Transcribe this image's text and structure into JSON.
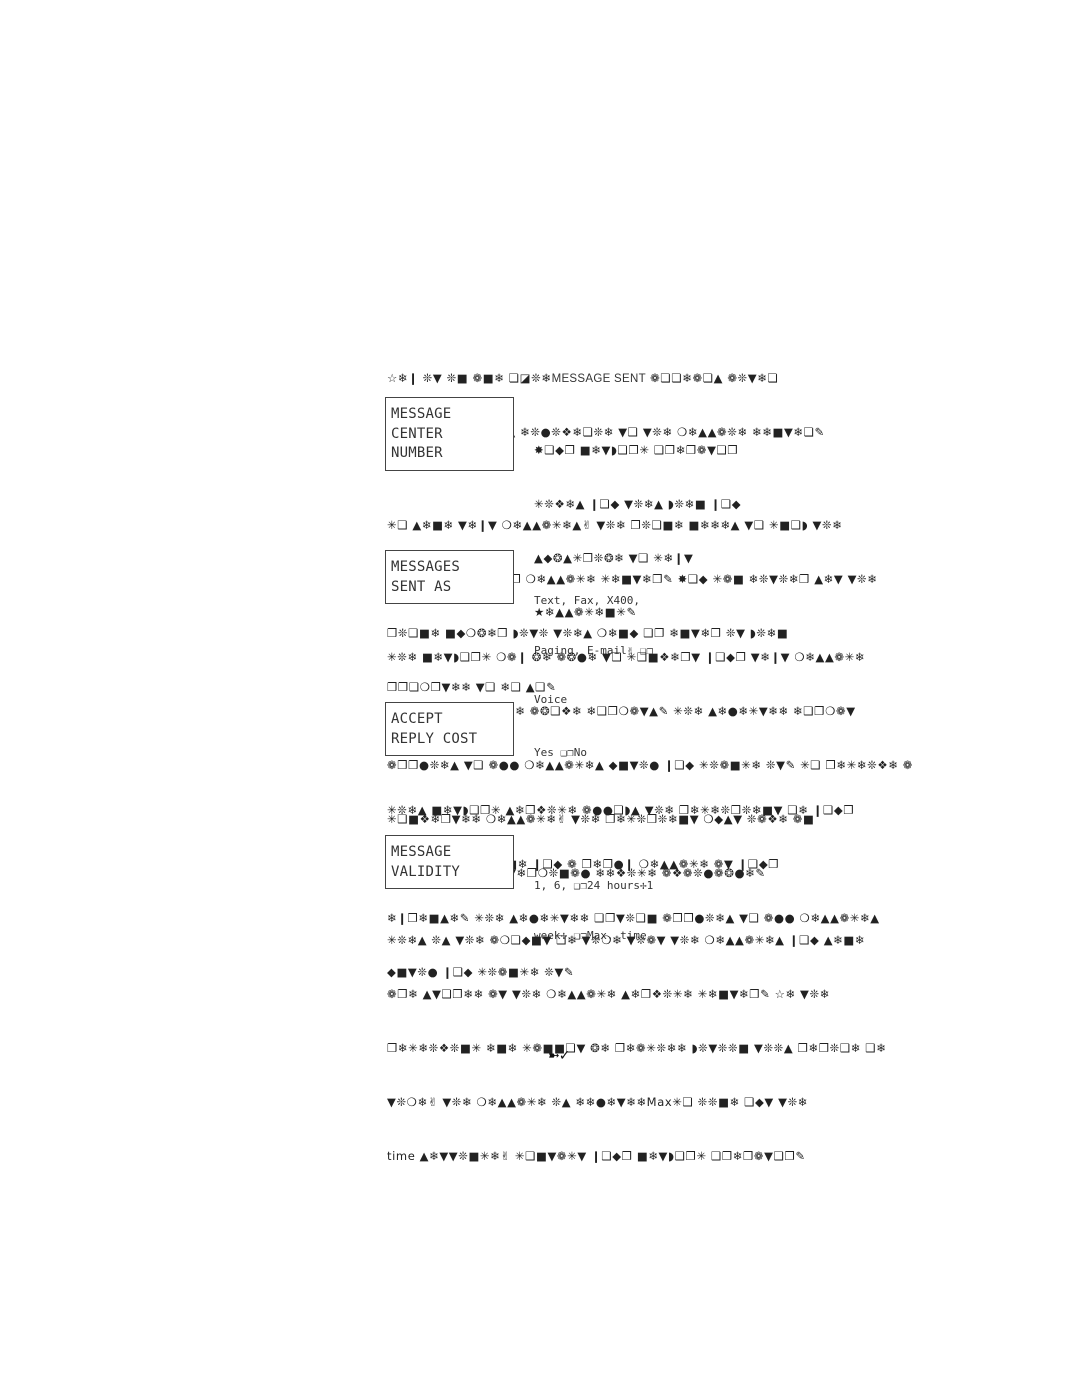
{
  "intro": {
    "lines": [
      "☆❄❙ ❊▼ ❊■ ❁■❄ ❏◪❊❄",
      "▼❊❄ ❍❄▲▲❁❊❄ ❊▲ ❄❊●❊❖❄❏❊❄ ▼❑ ▼❊❄ ❍❄▲▲❁❊❄ ❄❄■▼❄❏✎"
    ],
    "inline_readable": "MESSAGE SENT",
    "after_inline": " ❁❏❏❄❁❏▲ ❁❊▼❄❏"
  },
  "sections": [
    {
      "lcd_lines": [
        "MESSAGE",
        "CENTER",
        "NUMBER"
      ],
      "side_lines": [
        "✸❑◆❐ ■❄▼◗❑❐✳ ❑❐❄❐❁▼❑❐",
        "✳❊❖❄▲ ❙❑◆ ▼❊❄▲ ◗❊❄■ ❙❑◆",
        "▲◆❂▲✳❐❊❂❄ ▼❑ ✳❄❙▼",
        "★❄▲▲❁✳❄■✳✎"
      ],
      "body_lines": [
        "✳❑ ▲❄■❄ ▼❄❙▼ ❍❄▲▲❁✳❄▲✌ ▼❊❄ ❐❊❑■❄ ■❄❄❄▲ ▼❑ ✳■❑◗ ▼❊❄",
        "■◆❍❂❄❐ ❑❄ ❙❑◆❐ ❍❄▲▲❁✳❄ ✳❄■▼❄❐✎ ✸❑◆ ✳❁■ ❄❊▼❊❄❐ ▲❄▼ ▼❊❄",
        "❐❊❑■❄ ■◆❍❂❄❐ ◗❊▼❊ ▼❊❄▲ ❍❄■◆ ❑❐ ❄■▼❄❐ ❊▼ ◗❊❄■",
        "❐❐❑❍❐▼❄❄ ▼❑ ❄❑ ▲❑✎"
      ]
    },
    {
      "lcd_lines": [
        "MESSAGES",
        "SENT AS"
      ],
      "option_lines": [
        "Text, Fax, X400,",
        "Paging, E-mail✌ ❑❐",
        "Voice"
      ],
      "body_lines": [
        "✳❊❄ ■❄▼◗❑❐✳ ❍❁❙ ❂❄ ❁❂●❄ ▼❑ ✳❑■❖❄❐▼ ❙❑◆❐ ▼❄❙▼ ❍❄▲▲❁✳❄",
        "❊■▼❑ ❑■❄ ❑❄ ▼❊❄ ❁❂❑❖❄ ❄❑❐❍❁▼▲✎ ✳❊❄ ▲❄●❄✳▼❄❄ ❄❑❐❍❁▼",
        "❁❐❐●❊❄▲ ▼❑ ❁●● ❍❄▲▲❁✳❄▲ ◆■▼❊● ❙❑◆ ✳❊❁■✳❄ ❊▼✎ ✳❑ ❐❄✳❄❊❖❄ ❁",
        "✳❑■❖❄❐▼❄❄ ❍❄▲▲❁✳❄✌ ▼❊❄ ❐❄✳❊❐❊❄■▼ ❍◆▲▼ ❊❁❖❄ ❁■",
        "❁❐❐❐❑❐❐❊❁▼❄ ▼❄❐❍❊■❁● ❄❄❖❊✳❄ ❁❖❁❊●❁❂●❄✎"
      ]
    },
    {
      "lcd_lines": [
        "ACCEPT",
        "REPLY COST"
      ],
      "option_lines": [
        "Yes ❑❐No"
      ],
      "body_lines": [
        "✳❊❄▲ ■❄▼◗❑❐✳ ▲❄❐❖❊✳❄ ❁●●❑◗▲ ▼❊❄ ❐❄✳❄❊❐❊❄■▼ ❑❄ ❙❑◆❐",
        "❍❄▲▲❁✳❄ ▼❑ ▲❄■❄ ❙❑◆ ❁ ❐❄❐●❙ ❍❄▲▲❁✳❄ ❁▼ ❙❑◆❐",
        "❄❙❐❄■▲❄✎ ✳❊❄ ▲❄●❄✳▼❄❄ ❑❐▼❊❑■ ❁❐❐●❊❄▲ ▼❑ ❁●● ❍❄▲▲❁✳❄▲",
        "◆■▼❊● ❙❑◆ ✳❊❁■✳❄ ❊▼✎"
      ]
    },
    {
      "lcd_lines": [
        "MESSAGE",
        "VALIDITY"
      ],
      "option_lines": [
        "1, 6, ❑❐24 hours✢1",
        "week✢ ❑❐Max. time"
      ],
      "body_lines": [
        "✳❊❄▲ ❊▲ ▼❊❄ ❁❍❑◆■▼ ❑❄ ▼❊❍❄ ▼❊❁▼ ▼❊❄ ❍❄▲▲❁✳❄▲ ❙❑◆ ▲❄■❄",
        "❁❐❄ ▲▼❑❐❄❄ ❁▼ ▼❊❄ ❍❄▲▲❁✳❄ ▲❄❐❖❊✳❄ ✳❄■▼❄❐✎ ☆❄ ▼❊❄",
        "❐❄✳❄❊❖❊■✳ ❄■❄ ✳❁■■❑▼ ❂❄ ❐❄❁✳❊❄❄ ◗❊▼❊❊■ ▼❊❊▲ ❐❄❐❊❑❄ ❑❄",
        "▼❊❍❄✌ ▼❊❄ ❍❄▲▲❁✳❄ ❊▲ ❄❄●❄▼❄❄Max✳❑ ❊❊■❄ ❑◆▼ ▼❊❄",
        "time ▲❄▼▼❊■✳❄✌ ✳❑■▼❁✳▼ ❙❑◆❐ ■❄▼◗❑❐✳ ❑❐❄❐❁▼❑❐✎"
      ]
    }
  ],
  "footer": {
    "mark": "➼✓"
  }
}
